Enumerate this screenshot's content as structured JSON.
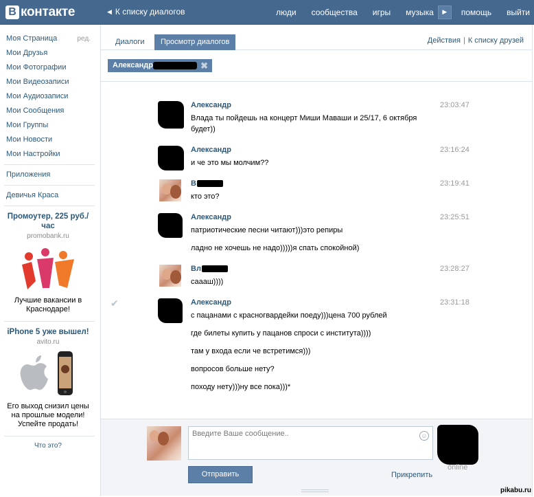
{
  "header": {
    "logo_letter": "B",
    "logo_text": "контакте",
    "back_link": "К списку диалогов",
    "nav": [
      "люди",
      "сообщества",
      "игры",
      "музыка",
      "помощь",
      "выйти"
    ]
  },
  "sidebar": {
    "items": [
      "Моя Страница",
      "Мои Друзья",
      "Мои Фотографии",
      "Мои Видеозаписи",
      "Мои Аудиозаписи",
      "Мои Сообщения",
      "Мои Группы",
      "Мои Новости",
      "Мои Настройки"
    ],
    "edit_label": "ред.",
    "apps": "Приложения",
    "group": "Девичья Краса",
    "ad1": {
      "title": "Промоутер, 225 руб./час",
      "domain": "promobank.ru",
      "text": "Лучшие вакансии в Краснодаре!"
    },
    "ad2": {
      "title": "iPhone 5 уже вышел!",
      "domain": "avito.ru",
      "text": "Его выход снизил цены на прошлые модели! Успейте продать!"
    },
    "what": "Что это?"
  },
  "tabs": {
    "dialogs": "Диалоги",
    "view": "Просмотр диалогов",
    "actions": "Действия",
    "friends": "К списку друзей"
  },
  "filter": {
    "chip_name": "Александр"
  },
  "messages": [
    {
      "author": "Александр",
      "time": "23:03:47",
      "lines": [
        "Влада ты пойдешь на концерт Миши Маваши и 25/17, 6 октября будет))"
      ]
    },
    {
      "author": "Александр",
      "time": "23:16:24",
      "lines": [
        "и че это мы молчим??"
      ]
    },
    {
      "author": "В",
      "time": "23:19:41",
      "lines": [
        "кто это?"
      ]
    },
    {
      "author": "Александр",
      "time": "23:25:51",
      "lines": [
        "патриотические песни читают)))это репиры",
        "ладно не хочешь не надо)))))я спать спокойной)"
      ]
    },
    {
      "author": "Вл",
      "time": "23:28:27",
      "lines": [
        "сааaш))))"
      ]
    },
    {
      "author": "Александр",
      "time": "23:31:18",
      "lines": [
        "с пацанами с красногвардейки поеду)))цена 700 рублей",
        "где билеты купить у пацанов спроси с института))))",
        "там у входа если че встретимся)))",
        "вопросов больше нету?",
        "походу нету)))ну все пока)))*"
      ]
    }
  ],
  "composer": {
    "placeholder": "Введите Ваше сообщение..",
    "send": "Отправить",
    "attach": "Прикрепить",
    "online": "online"
  },
  "watermark": "pikabu.ru"
}
